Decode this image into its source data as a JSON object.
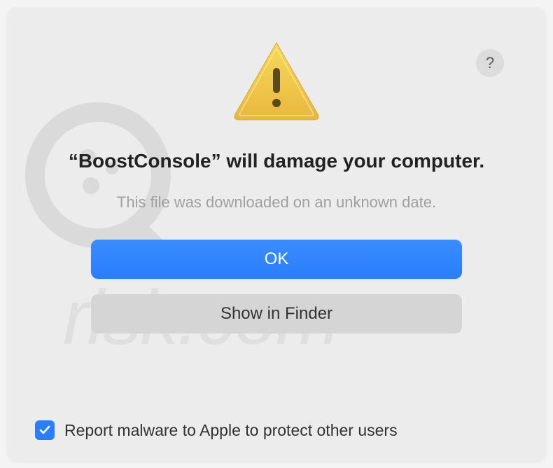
{
  "dialog": {
    "help": "?",
    "title": "“BoostConsole” will damage your computer.",
    "subtitle": "This file was downloaded on an unknown date.",
    "primary_button": "OK",
    "secondary_button": "Show in Finder",
    "checkbox_label": "Report malware to Apple to protect other users",
    "checkbox_checked": true
  },
  "watermark": {
    "text": "risk.com"
  }
}
